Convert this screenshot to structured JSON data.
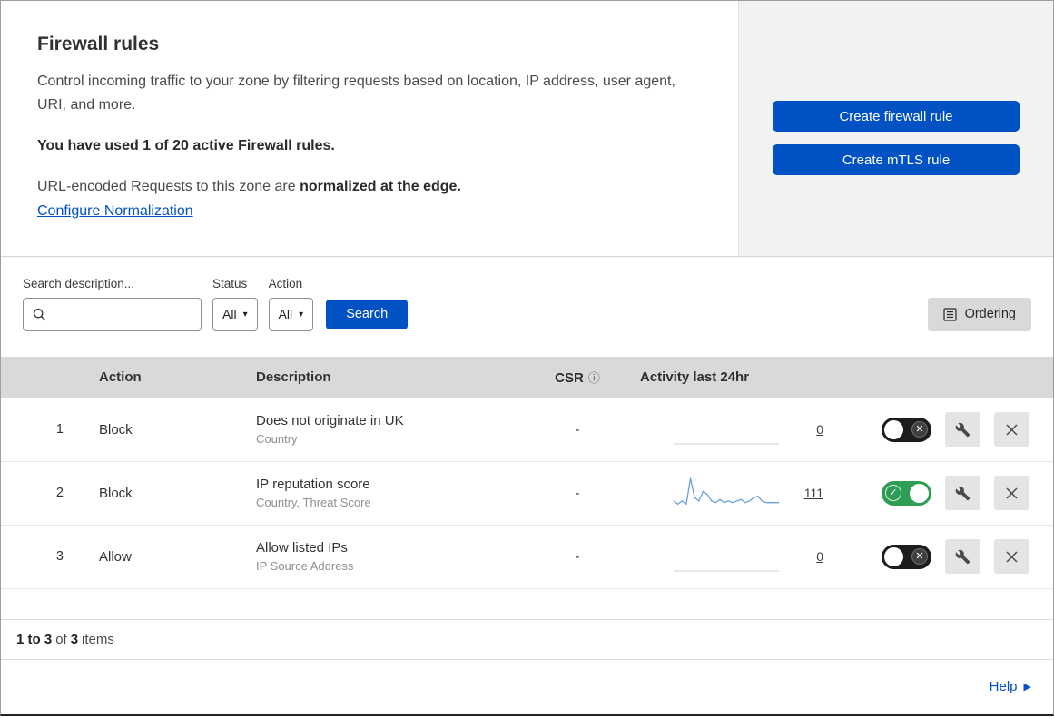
{
  "page": {
    "title": "Firewall rules",
    "description": "Control incoming traffic to your zone by filtering requests based on location, IP address, user agent, URI, and more.",
    "usage_text": "You have used 1 of 20 active Firewall rules.",
    "normalization_prefix": "URL-encoded Requests to this zone are ",
    "normalization_bold": "normalized at the edge.",
    "normalization_link": "Configure Normalization"
  },
  "actions": {
    "create_firewall_rule": "Create firewall rule",
    "create_mtls_rule": "Create mTLS rule"
  },
  "filters": {
    "search_label": "Search description...",
    "status_label": "Status",
    "status_value": "All",
    "action_label": "Action",
    "action_value": "All",
    "search_button": "Search",
    "ordering_button": "Ordering"
  },
  "table": {
    "columns": {
      "action": "Action",
      "description": "Description",
      "csr": "CSR",
      "info_icon": "ⓘ",
      "activity": "Activity last 24hr"
    },
    "rows": [
      {
        "num": "1",
        "action": "Block",
        "description": "Does not originate in UK",
        "fields": "Country",
        "csr": "-",
        "activity": "0",
        "enabled": false,
        "sparkline": [
          0,
          0,
          0,
          0,
          0,
          0,
          0,
          0,
          0,
          0
        ]
      },
      {
        "num": "2",
        "action": "Block",
        "description": "IP reputation score",
        "fields": "Country, Threat Score",
        "csr": "-",
        "activity": "111",
        "enabled": true,
        "sparkline": [
          2,
          1,
          2,
          1,
          9,
          3,
          2,
          5,
          4,
          2,
          1.5,
          2.5,
          1.5,
          2,
          1.5,
          2,
          2.5,
          1.5,
          2,
          3,
          3.5,
          2,
          1.5,
          1.5,
          1.5,
          1.5
        ]
      },
      {
        "num": "3",
        "action": "Allow",
        "description": "Allow listed IPs",
        "fields": "IP Source Address",
        "csr": "-",
        "activity": "0",
        "enabled": false,
        "sparkline": [
          0,
          0,
          0,
          0,
          0,
          0,
          0,
          0,
          0,
          0
        ]
      }
    ]
  },
  "footer": {
    "range": "1 to 3",
    "of_text": "of",
    "total": "3",
    "items_text": "items",
    "help_label": "Help"
  },
  "colors": {
    "accent": "#0051c3",
    "toggle_on": "#2f9e55",
    "sparkline": "#6b9fd8",
    "sparkline_flat": "#d9d9d9"
  }
}
